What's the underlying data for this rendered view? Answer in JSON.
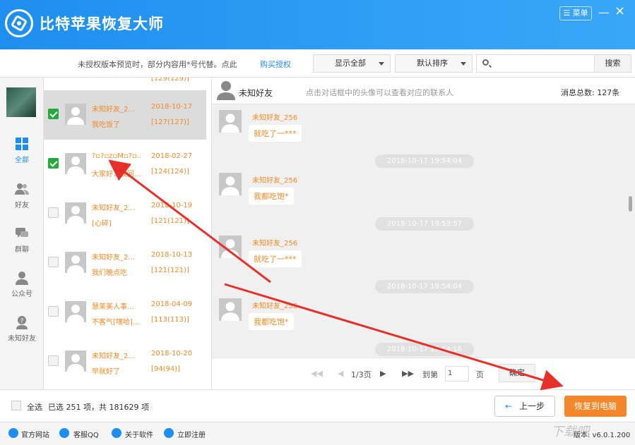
{
  "app": {
    "title": "比特苹果恢复大师",
    "menu_label": "菜单",
    "minimize": "—",
    "close": "×"
  },
  "toolbar": {
    "notice": "未授权版本预览时，部分内容用*号代替。点此",
    "buy_link": "购买授权",
    "filter_dropdown": "显示全部",
    "sort_dropdown": "默认排序",
    "search_placeholder": "",
    "search_button": "搜索"
  },
  "sidebar": {
    "items": [
      {
        "label": "全部",
        "icon": "grid-icon",
        "active": true
      },
      {
        "label": "好友",
        "icon": "friends-icon",
        "active": false
      },
      {
        "label": "群聊",
        "icon": "group-chat-icon",
        "active": false
      },
      {
        "label": "公众号",
        "icon": "official-account-icon",
        "active": false
      },
      {
        "label": "未知好友",
        "icon": "unknown-friend-icon",
        "active": false
      }
    ]
  },
  "conversations": [
    {
      "name": "未知好友_2...",
      "date": "2018-10-17",
      "message": "我吃饭了",
      "count": "[127(127)]",
      "checked": true,
      "selected": true
    },
    {
      "name": "?▫?▫z▫M▫?▫...",
      "date": "2018-02-27",
      "message": "大家好，我回...",
      "count": "[124(124)]",
      "checked": true,
      "selected": false
    },
    {
      "name": "未知好友_2...",
      "date": "2018-10-19",
      "message": "[心碎]",
      "count": "[121(121)]",
      "checked": false,
      "selected": false
    },
    {
      "name": "未知好友_2...",
      "date": "2018-10-13",
      "message": "我们晚点吃",
      "count": "[121(121)]",
      "checked": false,
      "selected": false
    },
    {
      "name": "慧莱美人事...",
      "date": "2018-04-09",
      "message": "不客气[嘿哈]...",
      "count": "[113(113)]",
      "checked": false,
      "selected": false
    },
    {
      "name": "未知好友_2...",
      "date": "2018-10-20",
      "message": "早就好了",
      "count": "[94(94)]",
      "checked": false,
      "selected": false
    }
  ],
  "chat": {
    "header_name": "未知好友",
    "hint": "点击对话框中的头像可以查看对应的联系人",
    "total": "消息总数: 127条",
    "messages": [
      {
        "sender": "未知好友_256",
        "text": "就吃了一***"
      },
      {
        "timestamp": "2018-10-17 19:54:04"
      },
      {
        "sender": "未知好友_256",
        "text": "我都吃饱*"
      },
      {
        "timestamp": "2018-10-17 19:53:57"
      },
      {
        "sender": "未知好友_256",
        "text": "就吃了一***"
      },
      {
        "timestamp": "2018-10-17 19:54:04"
      },
      {
        "sender": "未知好友_256",
        "text": "我都吃饱*"
      },
      {
        "timestamp": "2018-10-17 19:54:16"
      }
    ]
  },
  "pager": {
    "page_info": "1/3页",
    "goto_label": "到第",
    "page_value": "1",
    "page_unit": "页",
    "go_button": "确定"
  },
  "bottom": {
    "select_all": "全选",
    "selection_info": "已选 251 项，共 181629 项",
    "prev_button": "上一步",
    "recover_button": "恢复到电脑"
  },
  "footer": {
    "links": [
      "官方网站",
      "客服QQ",
      "关于软件",
      "立即注册"
    ],
    "version": "版本: v6.0.1.200"
  },
  "watermark": "下载吧",
  "colors": {
    "primary": "#1e8ef0",
    "accent_orange": "#f08a24",
    "recover_button": "#f5862a",
    "check_green": "#25a93a",
    "annotation_arrow": "#e8302a"
  }
}
